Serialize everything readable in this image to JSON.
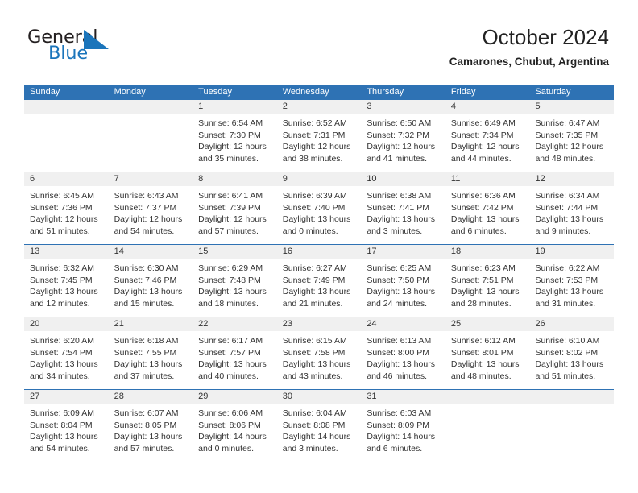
{
  "brand": {
    "name_part1": "General",
    "name_part2": "Blue",
    "triangle_icon": "blue-triangle-logo-mark",
    "color_dark": "#231f20",
    "color_blue": "#1b75bb"
  },
  "header": {
    "month_title": "October 2024",
    "location": "Camarones, Chubut, Argentina"
  },
  "theme": {
    "header_blue": "#2e72b4",
    "day_band_gray": "#f0f0f0",
    "text": "#333333"
  },
  "calendar": {
    "weekdays": [
      "Sunday",
      "Monday",
      "Tuesday",
      "Wednesday",
      "Thursday",
      "Friday",
      "Saturday"
    ],
    "weeks": [
      [
        {
          "day": "",
          "lines": []
        },
        {
          "day": "",
          "lines": []
        },
        {
          "day": "1",
          "lines": [
            "Sunrise: 6:54 AM",
            "Sunset: 7:30 PM",
            "Daylight: 12 hours",
            "and 35 minutes."
          ]
        },
        {
          "day": "2",
          "lines": [
            "Sunrise: 6:52 AM",
            "Sunset: 7:31 PM",
            "Daylight: 12 hours",
            "and 38 minutes."
          ]
        },
        {
          "day": "3",
          "lines": [
            "Sunrise: 6:50 AM",
            "Sunset: 7:32 PM",
            "Daylight: 12 hours",
            "and 41 minutes."
          ]
        },
        {
          "day": "4",
          "lines": [
            "Sunrise: 6:49 AM",
            "Sunset: 7:34 PM",
            "Daylight: 12 hours",
            "and 44 minutes."
          ]
        },
        {
          "day": "5",
          "lines": [
            "Sunrise: 6:47 AM",
            "Sunset: 7:35 PM",
            "Daylight: 12 hours",
            "and 48 minutes."
          ]
        }
      ],
      [
        {
          "day": "6",
          "lines": [
            "Sunrise: 6:45 AM",
            "Sunset: 7:36 PM",
            "Daylight: 12 hours",
            "and 51 minutes."
          ]
        },
        {
          "day": "7",
          "lines": [
            "Sunrise: 6:43 AM",
            "Sunset: 7:37 PM",
            "Daylight: 12 hours",
            "and 54 minutes."
          ]
        },
        {
          "day": "8",
          "lines": [
            "Sunrise: 6:41 AM",
            "Sunset: 7:39 PM",
            "Daylight: 12 hours",
            "and 57 minutes."
          ]
        },
        {
          "day": "9",
          "lines": [
            "Sunrise: 6:39 AM",
            "Sunset: 7:40 PM",
            "Daylight: 13 hours",
            "and 0 minutes."
          ]
        },
        {
          "day": "10",
          "lines": [
            "Sunrise: 6:38 AM",
            "Sunset: 7:41 PM",
            "Daylight: 13 hours",
            "and 3 minutes."
          ]
        },
        {
          "day": "11",
          "lines": [
            "Sunrise: 6:36 AM",
            "Sunset: 7:42 PM",
            "Daylight: 13 hours",
            "and 6 minutes."
          ]
        },
        {
          "day": "12",
          "lines": [
            "Sunrise: 6:34 AM",
            "Sunset: 7:44 PM",
            "Daylight: 13 hours",
            "and 9 minutes."
          ]
        }
      ],
      [
        {
          "day": "13",
          "lines": [
            "Sunrise: 6:32 AM",
            "Sunset: 7:45 PM",
            "Daylight: 13 hours",
            "and 12 minutes."
          ]
        },
        {
          "day": "14",
          "lines": [
            "Sunrise: 6:30 AM",
            "Sunset: 7:46 PM",
            "Daylight: 13 hours",
            "and 15 minutes."
          ]
        },
        {
          "day": "15",
          "lines": [
            "Sunrise: 6:29 AM",
            "Sunset: 7:48 PM",
            "Daylight: 13 hours",
            "and 18 minutes."
          ]
        },
        {
          "day": "16",
          "lines": [
            "Sunrise: 6:27 AM",
            "Sunset: 7:49 PM",
            "Daylight: 13 hours",
            "and 21 minutes."
          ]
        },
        {
          "day": "17",
          "lines": [
            "Sunrise: 6:25 AM",
            "Sunset: 7:50 PM",
            "Daylight: 13 hours",
            "and 24 minutes."
          ]
        },
        {
          "day": "18",
          "lines": [
            "Sunrise: 6:23 AM",
            "Sunset: 7:51 PM",
            "Daylight: 13 hours",
            "and 28 minutes."
          ]
        },
        {
          "day": "19",
          "lines": [
            "Sunrise: 6:22 AM",
            "Sunset: 7:53 PM",
            "Daylight: 13 hours",
            "and 31 minutes."
          ]
        }
      ],
      [
        {
          "day": "20",
          "lines": [
            "Sunrise: 6:20 AM",
            "Sunset: 7:54 PM",
            "Daylight: 13 hours",
            "and 34 minutes."
          ]
        },
        {
          "day": "21",
          "lines": [
            "Sunrise: 6:18 AM",
            "Sunset: 7:55 PM",
            "Daylight: 13 hours",
            "and 37 minutes."
          ]
        },
        {
          "day": "22",
          "lines": [
            "Sunrise: 6:17 AM",
            "Sunset: 7:57 PM",
            "Daylight: 13 hours",
            "and 40 minutes."
          ]
        },
        {
          "day": "23",
          "lines": [
            "Sunrise: 6:15 AM",
            "Sunset: 7:58 PM",
            "Daylight: 13 hours",
            "and 43 minutes."
          ]
        },
        {
          "day": "24",
          "lines": [
            "Sunrise: 6:13 AM",
            "Sunset: 8:00 PM",
            "Daylight: 13 hours",
            "and 46 minutes."
          ]
        },
        {
          "day": "25",
          "lines": [
            "Sunrise: 6:12 AM",
            "Sunset: 8:01 PM",
            "Daylight: 13 hours",
            "and 48 minutes."
          ]
        },
        {
          "day": "26",
          "lines": [
            "Sunrise: 6:10 AM",
            "Sunset: 8:02 PM",
            "Daylight: 13 hours",
            "and 51 minutes."
          ]
        }
      ],
      [
        {
          "day": "27",
          "lines": [
            "Sunrise: 6:09 AM",
            "Sunset: 8:04 PM",
            "Daylight: 13 hours",
            "and 54 minutes."
          ]
        },
        {
          "day": "28",
          "lines": [
            "Sunrise: 6:07 AM",
            "Sunset: 8:05 PM",
            "Daylight: 13 hours",
            "and 57 minutes."
          ]
        },
        {
          "day": "29",
          "lines": [
            "Sunrise: 6:06 AM",
            "Sunset: 8:06 PM",
            "Daylight: 14 hours",
            "and 0 minutes."
          ]
        },
        {
          "day": "30",
          "lines": [
            "Sunrise: 6:04 AM",
            "Sunset: 8:08 PM",
            "Daylight: 14 hours",
            "and 3 minutes."
          ]
        },
        {
          "day": "31",
          "lines": [
            "Sunrise: 6:03 AM",
            "Sunset: 8:09 PM",
            "Daylight: 14 hours",
            "and 6 minutes."
          ]
        },
        {
          "day": "",
          "lines": []
        },
        {
          "day": "",
          "lines": []
        }
      ]
    ]
  }
}
